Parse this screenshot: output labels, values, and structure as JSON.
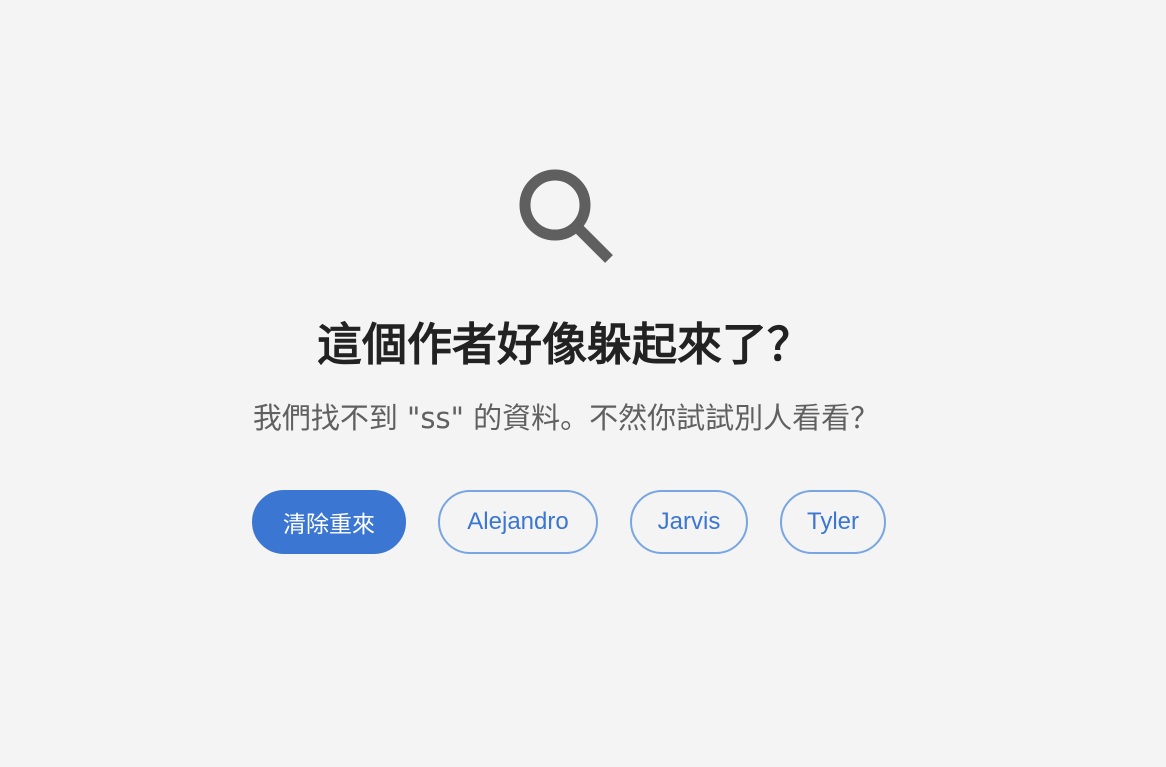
{
  "empty_state": {
    "icon": "search-icon",
    "title": "這個作者好像躲起來了？",
    "message": "我們找不到 \"ss\" 的資料。不然你試試別人看看？",
    "actions": {
      "clear_label": "清除重來",
      "suggestions": [
        "Alejandro",
        "Jarvis",
        "Tyler"
      ]
    }
  },
  "colors": {
    "background": "#f4f4f4",
    "title": "#222222",
    "message": "#606060",
    "icon": "#5f5f5f",
    "accent": "#3a76d2",
    "outline_border": "#77a6e2"
  }
}
